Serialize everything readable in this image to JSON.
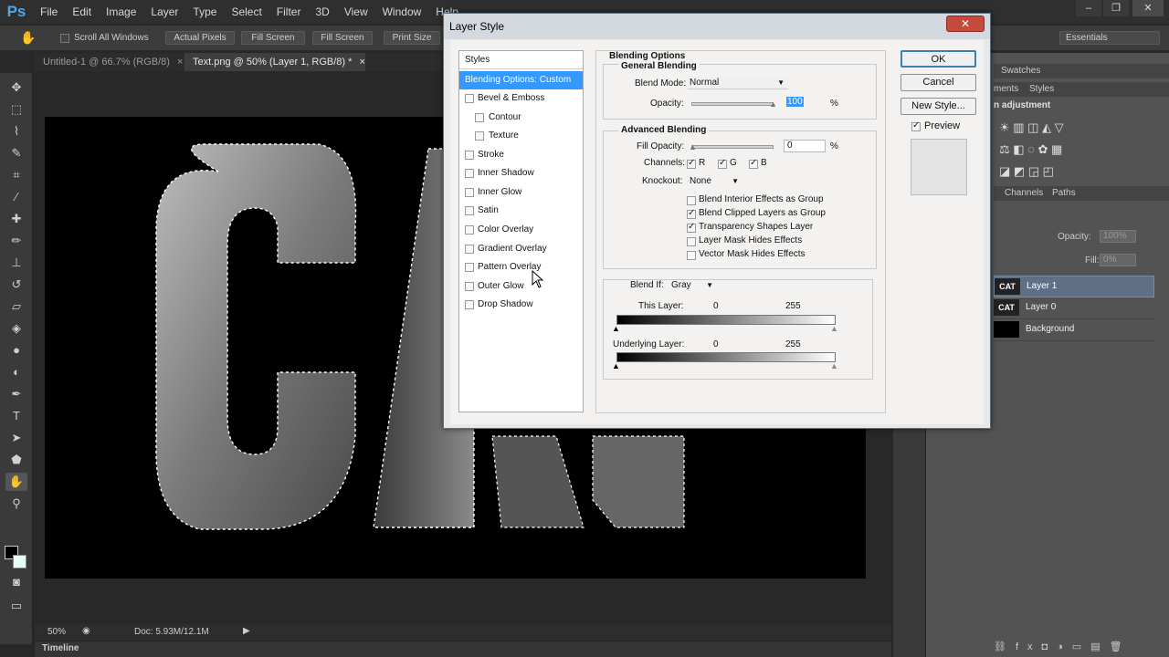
{
  "app": {
    "logo": "Ps"
  },
  "menubar": {
    "items": [
      "File",
      "Edit",
      "Image",
      "Layer",
      "Type",
      "Select",
      "Filter",
      "3D",
      "View",
      "Window",
      "Help"
    ]
  },
  "window_controls": {
    "minimize": "–",
    "restore": "❐",
    "close": "✕"
  },
  "options_bar": {
    "scroll_all_label": "Scroll All Windows",
    "buttons": [
      "Actual Pixels",
      "Fill Screen",
      "Fill Screen",
      "Print Size"
    ],
    "workspace": "Essentials"
  },
  "doc_tabs": [
    {
      "label": "Untitled-1 @ 66.7% (RGB/8)",
      "close": "×"
    },
    {
      "label": "Text.png @ 50% (Layer 1, RGB/8) *",
      "close": "×"
    }
  ],
  "status": {
    "zoom": "50%",
    "doc": "Doc: 5.93M/12.1M"
  },
  "timeline": {
    "label": "Timeline"
  },
  "right_panel": {
    "swatches": "Swatches",
    "adjustments": "n adjustment",
    "tabs": [
      "ments",
      "Styles"
    ],
    "layers_tabs": [
      "Channels",
      "Paths"
    ],
    "opacity_label": "Opacity:",
    "opacity_value": "100%",
    "fill_label": "Fill:",
    "fill_value": "0%",
    "layers": [
      {
        "thumb": "CAT",
        "name": "Layer 1"
      },
      {
        "thumb": "CAT",
        "name": "Layer 0"
      },
      {
        "thumb": "",
        "name": "Background"
      }
    ]
  },
  "canvas": {
    "text": "CAT"
  },
  "dialog": {
    "title": "Layer Style",
    "close": "✕",
    "styles_header": "Styles",
    "styles": [
      {
        "label": "Blending Options: Custom",
        "checked": false
      },
      {
        "label": "Bevel & Emboss",
        "checked": false
      },
      {
        "label": "Contour",
        "checked": false
      },
      {
        "label": "Texture",
        "checked": false
      },
      {
        "label": "Stroke",
        "checked": false
      },
      {
        "label": "Inner Shadow",
        "checked": false
      },
      {
        "label": "Inner Glow",
        "checked": false
      },
      {
        "label": "Satin",
        "checked": false
      },
      {
        "label": "Color Overlay",
        "checked": false
      },
      {
        "label": "Gradient Overlay",
        "checked": false
      },
      {
        "label": "Pattern Overlay",
        "checked": false
      },
      {
        "label": "Outer Glow",
        "checked": false
      },
      {
        "label": "Drop Shadow",
        "checked": false
      }
    ],
    "blending_title": "Blending Options",
    "general_title": "General Blending",
    "blend_mode_label": "Blend Mode:",
    "blend_mode_value": "Normal",
    "opacity_label": "Opacity:",
    "opacity_value": "100",
    "percent": "%",
    "advanced_title": "Advanced Blending",
    "fill_opacity_label": "Fill Opacity:",
    "fill_opacity_value": "0",
    "channels_label": "Channels:",
    "channels": [
      "R",
      "G",
      "B"
    ],
    "knockout_label": "Knockout:",
    "knockout_value": "None",
    "advanced_options": [
      {
        "label": "Blend Interior Effects as Group",
        "checked": false
      },
      {
        "label": "Blend Clipped Layers as Group",
        "checked": true
      },
      {
        "label": "Transparency Shapes Layer",
        "checked": true
      },
      {
        "label": "Layer Mask Hides Effects",
        "checked": false
      },
      {
        "label": "Vector Mask Hides Effects",
        "checked": false
      }
    ],
    "blend_if_label": "Blend If:",
    "blend_if_value": "Gray",
    "this_layer_label": "This Layer:",
    "this_layer_min": "0",
    "this_layer_max": "255",
    "underlying_label": "Underlying Layer:",
    "underlying_min": "0",
    "underlying_max": "255",
    "ok": "OK",
    "cancel": "Cancel",
    "new_style": "New Style...",
    "preview_label": "Preview"
  }
}
